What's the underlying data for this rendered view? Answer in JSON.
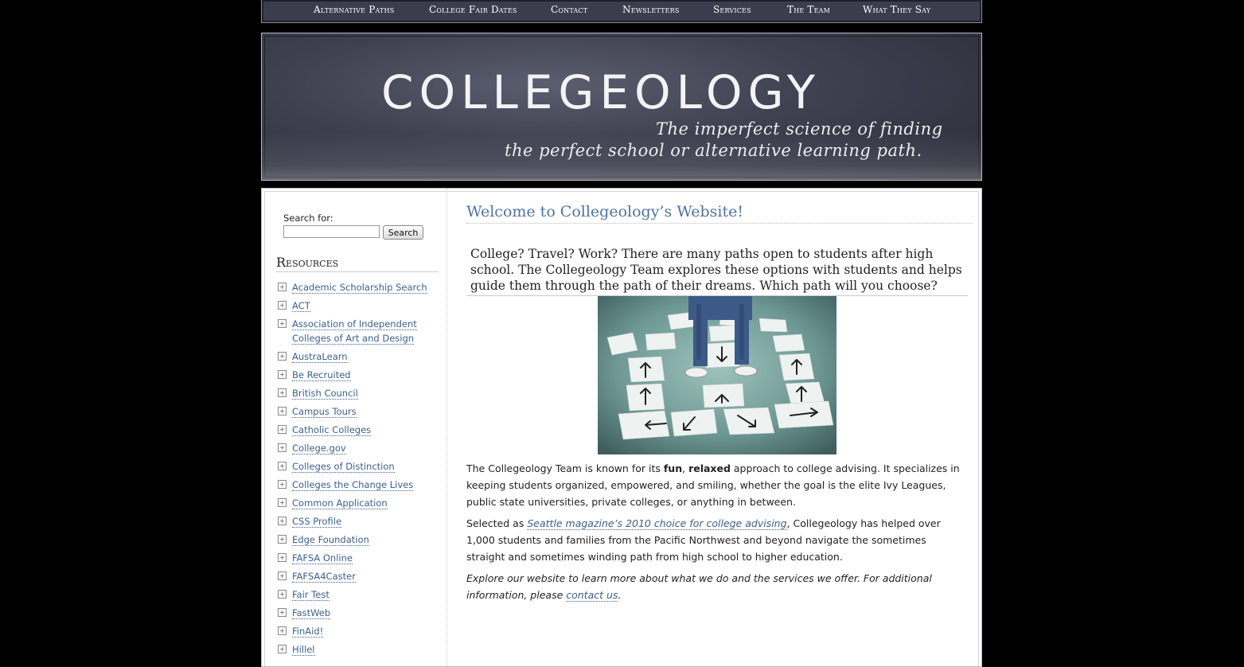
{
  "nav": {
    "items": [
      {
        "label": "Alternative Paths"
      },
      {
        "label": "College Fair Dates"
      },
      {
        "label": "Contact"
      },
      {
        "label": "Newsletters"
      },
      {
        "label": "Services"
      },
      {
        "label": "The Team"
      },
      {
        "label": "What They Say"
      }
    ]
  },
  "header": {
    "logo": "COLLEGEOLOGY",
    "tagline_line1": "The imperfect science of finding",
    "tagline_line2": "the perfect school or alternative learning path."
  },
  "search": {
    "label": "Search for:",
    "value": "",
    "button": "Search"
  },
  "resources": {
    "title": "Resources",
    "items": [
      "Academic Scholarship Search",
      "ACT",
      "Association of Independent Colleges of Art and Design",
      "AustraLearn",
      "Be Recruited",
      "British Council",
      "Campus Tours",
      "Catholic Colleges",
      "College.gov",
      "Colleges of Distinction",
      "Colleges the Change Lives",
      "Common Application",
      "CSS Profile",
      "Edge Foundation",
      "FAFSA Online",
      "FAFSA4Caster",
      "Fair Test",
      "FastWeb",
      "FinAid!",
      "Hillel"
    ]
  },
  "main": {
    "title": "Welcome to Collegeology’s Website!",
    "intro": "College? Travel? Work? There are many paths open to students after high school. The Collegeology Team explores these options with students and helps guide them through the path of their dreams. Which path will you choose?",
    "p1_a": "The Collegeology Team is known for its ",
    "p1_fun": "fun",
    "p1_comma": ", ",
    "p1_relaxed": "relaxed",
    "p1_b": " approach to college advising. It specializes in keeping students organized, empowered, and smiling, whether the goal is the elite Ivy Leagues, public state universities, private colleges, or anything in between.",
    "p2_a": "Selected as ",
    "p2_link": "Seattle magazine’s 2010 choice for college advising",
    "p2_b": ", Collegeology has helped over 1,000 students and families from the Pacific Northwest and beyond navigate the sometimes straight and sometimes winding path from high school to higher education.",
    "p3_a": "Explore our website to learn more about what we do and the services we offer. For additional information, please ",
    "p3_link": "contact us",
    "p3_b": "."
  },
  "colors": {
    "background": "#000000",
    "nav_bg": "#3b3d4e",
    "link": "#3d5f8c",
    "title": "#4f73a0"
  }
}
